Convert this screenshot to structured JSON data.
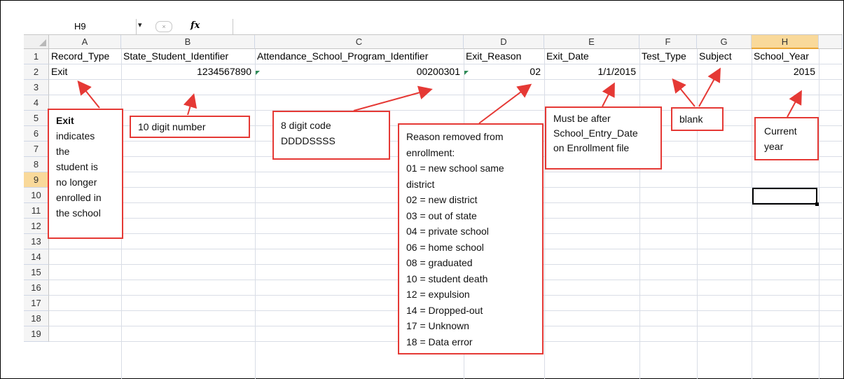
{
  "formula_bar": {
    "name_box": "H9",
    "dropdown_glyph": "▾",
    "cancel_glyph": "×",
    "fx_label": "fx",
    "formula_value": ""
  },
  "columns": [
    "A",
    "B",
    "C",
    "D",
    "E",
    "F",
    "G",
    "H"
  ],
  "rows": [
    "1",
    "2",
    "3",
    "4",
    "5",
    "6",
    "7",
    "8",
    "9",
    "10",
    "11",
    "12",
    "13",
    "14",
    "15",
    "16",
    "17",
    "18",
    "19"
  ],
  "headers": {
    "A": "Record_Type",
    "B": "State_Student_Identifier",
    "C": "Attendance_School_Program_Identifier",
    "D": "Exit_Reason",
    "E": "Exit_Date",
    "F": "Test_Type",
    "G": "Subject",
    "H": "School_Year"
  },
  "data_row": {
    "A": "Exit",
    "B": "1234567890",
    "C": "00200301",
    "D": "02",
    "E": "1/1/2015",
    "F": "",
    "G": "",
    "H": "2015"
  },
  "annotations": {
    "record_type": [
      "Exit",
      "indicates",
      "the",
      "student is",
      "no longer",
      "enrolled in",
      "the school"
    ],
    "student_id": "10 digit number",
    "school_program": [
      "8 digit code",
      "DDDDSSSS"
    ],
    "exit_reason": [
      "Reason removed from",
      "enrollment:",
      "01 = new school same",
      "district",
      "02 = new district",
      "03 =  out of state",
      "04 = private school",
      "06 = home school",
      "08 = graduated",
      "10 = student death",
      "12 = expulsion",
      "14 = Dropped-out",
      "17 = Unknown",
      "18 = Data error"
    ],
    "exit_date": [
      "Must be after",
      "School_Entry_Date",
      "on Enrollment file"
    ],
    "blank": "blank",
    "school_year": [
      "Current",
      "year"
    ]
  },
  "colors": {
    "annotation_border": "#e53935",
    "selected_header": "#f9d99a",
    "grid_line": "#d9dde6"
  }
}
